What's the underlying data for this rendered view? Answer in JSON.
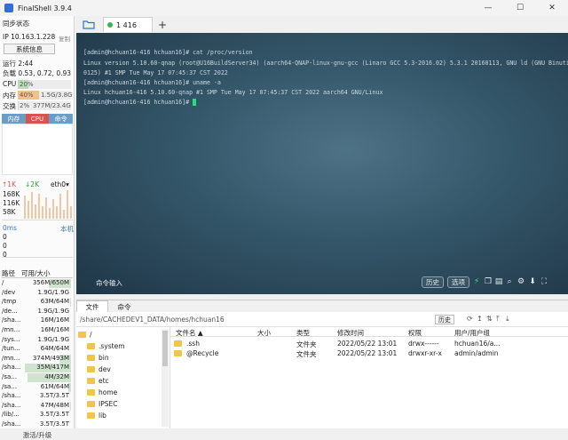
{
  "window": {
    "title": "FinalShell 3.9.4",
    "controls": [
      "—",
      "☐",
      "✕"
    ]
  },
  "sidebar": {
    "sync_status": "同步状态",
    "ip": "IP 10.163.1.228",
    "copy": "复制",
    "sys_info_button": "系统信息",
    "uptime": "运行 2:44",
    "load": "负载 0.53, 0.72, 0.93",
    "cpu": {
      "label": "CPU",
      "value": "20%",
      "percent": 20
    },
    "mem": {
      "label": "内存",
      "percent_text": "40%",
      "detail": "1.5G/3.8G",
      "percent": 40
    },
    "swap": {
      "label": "交换",
      "percent_text": "2%",
      "detail": "377M/23.4G",
      "percent": 2
    },
    "proc_tabs": [
      "内存",
      "CPU",
      "命令"
    ],
    "net": {
      "up": "1K",
      "down": "2K",
      "iface": "eth0",
      "levels": [
        "168K",
        "116K",
        "58K"
      ]
    },
    "ping": {
      "ms": "0ms",
      "host": "本机",
      "values": [
        "0",
        "0",
        "0"
      ]
    },
    "disk_header": {
      "path": "路径",
      "size": "可用/大小"
    },
    "disks": [
      {
        "path": "/",
        "size": "356M/650M",
        "usage": 0.45
      },
      {
        "path": "/dev",
        "size": "1.9G/1.9G",
        "usage": 0.0
      },
      {
        "path": "/tmp",
        "size": "63M/64M",
        "usage": 0.02
      },
      {
        "path": "/de...",
        "size": "1.9G/1.9G",
        "usage": 0.0
      },
      {
        "path": "/sha...",
        "size": "16M/16M",
        "usage": 0.0
      },
      {
        "path": "/mn...",
        "size": "16M/16M",
        "usage": 0.0
      },
      {
        "path": "/sys...",
        "size": "1.9G/1.9G",
        "usage": 0.0
      },
      {
        "path": "/tun...",
        "size": "64M/64M",
        "usage": 0.0
      },
      {
        "path": "/mn...",
        "size": "374M/493M",
        "usage": 0.24
      },
      {
        "path": "/sha...",
        "size": "35M/417M",
        "usage": 0.92
      },
      {
        "path": "/sa...",
        "size": "4M/32M",
        "usage": 0.88
      },
      {
        "path": "/sa...",
        "size": "61M/64M",
        "usage": 0.05
      },
      {
        "path": "/sha...",
        "size": "3.5T/3.5T",
        "usage": 0.0
      },
      {
        "path": "/sha...",
        "size": "47M/48M",
        "usage": 0.02
      },
      {
        "path": "/lib/...",
        "size": "3.5T/3.5T",
        "usage": 0.0
      },
      {
        "path": "/sha...",
        "size": "3.5T/3.5T",
        "usage": 0.0
      }
    ],
    "upgrade": "激活/升级"
  },
  "tabs": {
    "session": "1 416",
    "add": "+"
  },
  "terminal": {
    "lines": [
      "[admin@hchuan16-416 hchuan16]# cat /proc/version",
      "Linux version 5.10.60-qnap (root@U16BuildServer34) (aarch64-QNAP-linux-gnu-gcc (Linaro GCC 5.3-2016.02) 5.3.1 20160113, GNU ld (GNU Binutils) 2.26.2016",
      "0125) #1 SMP Tue May 17 07:45:37 CST 2022",
      "[admin@hchuan16-416 hchuan16]# uname -a",
      "Linux hchuan16-416 5.10.60-qnap #1 SMP Tue May 17 07:45:37 CST 2022 aarch64 GNU/Linux",
      "[admin@hchuan16-416 hchuan16]# "
    ]
  },
  "cmd": {
    "label": "命令输入",
    "history": "历史",
    "options": "选项"
  },
  "panel_tabs": [
    "文件",
    "命令"
  ],
  "pathbar": {
    "path": "/share/CACHEDEV1_DATA/homes/hchuan16",
    "history": "历史"
  },
  "tree": {
    "root": "/",
    "items": [
      ".system",
      "bin",
      "dev",
      "etc",
      "home",
      "IPSEC",
      "lib"
    ]
  },
  "filelist": {
    "headers": [
      "文件名 ▲",
      "大小",
      "类型",
      "修改时间",
      "权限",
      "用户/用户组"
    ],
    "rows": [
      {
        "name": ".ssh",
        "size": "",
        "type": "文件夹",
        "mtime": "2022/05/22 13:01",
        "perm": "drwx------",
        "owner": "hchuan16/a..."
      },
      {
        "name": "@Recycle",
        "size": "",
        "type": "文件夹",
        "mtime": "2022/05/22 13:01",
        "perm": "drwxr-xr-x",
        "owner": "admin/admin"
      }
    ]
  },
  "colors": {
    "cpu_bar": "#b5e0b5",
    "mem_bar": "#f4c08a",
    "swap_bar": "#d8d8d8",
    "cursor": "#26e07a",
    "session_dot": "#3bb54a"
  }
}
